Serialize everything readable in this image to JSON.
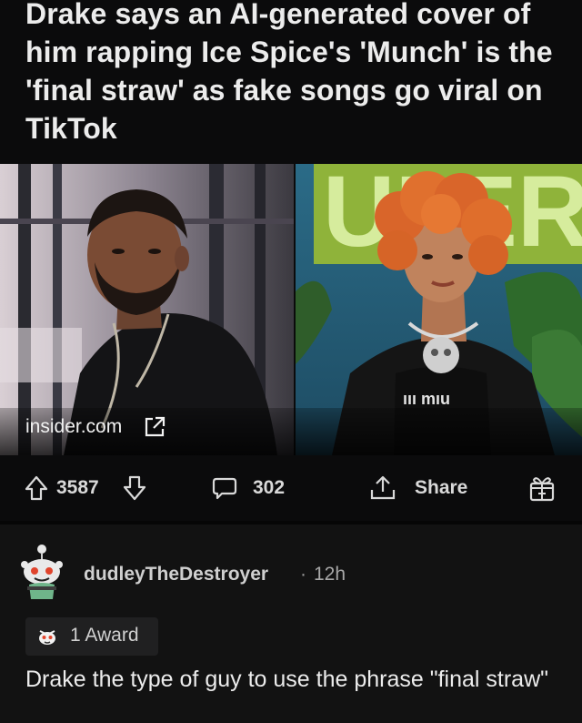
{
  "post": {
    "title": "Drake says an AI-generated cover of him rapping Ice Spice's 'Munch' is the 'final straw' as fake songs go viral on TikTok",
    "link_domain": "insider.com",
    "image_left_desc_icon": "photo-man-black-tee",
    "image_right_desc_icon": "photo-woman-orange-curls",
    "right_photo_sign_text": "UI     ERS",
    "right_photo_shirt_text": "ııı mıu",
    "upvote_count": "3587",
    "comment_count": "302",
    "share_label": "Share",
    "icons": {
      "upvote": "arrow-up-outline-icon",
      "downvote": "arrow-down-outline-icon",
      "comments": "speech-bubble-icon",
      "share": "share-up-arrow-icon",
      "award": "gift-box-icon",
      "external_link": "external-link-icon"
    }
  },
  "comment": {
    "username": "dudleyTheDestroyer",
    "separator": "·",
    "time": "12h",
    "award_label": "1 Award",
    "body": "Drake the type of guy to use the phrase \"final straw\""
  },
  "colors": {
    "background": "#0b0b0c",
    "comment_background": "#121212",
    "text": "#ececec",
    "muted": "#a7a7a7"
  }
}
